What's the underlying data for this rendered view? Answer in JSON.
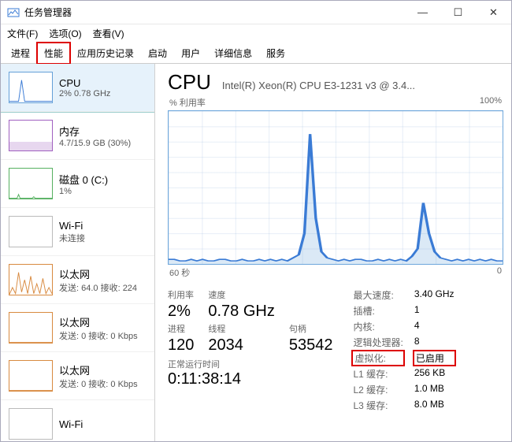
{
  "window": {
    "title": "任务管理器",
    "minimize": "—",
    "maximize": "☐",
    "close": "✕"
  },
  "menu": {
    "file": "文件(F)",
    "options": "选项(O)",
    "view": "查看(V)"
  },
  "tabs": {
    "processes": "进程",
    "performance": "性能",
    "app_history": "应用历史记录",
    "startup": "启动",
    "users": "用户",
    "details": "详细信息",
    "services": "服务"
  },
  "sidebar": [
    {
      "name": "cpu",
      "title": "CPU",
      "sub": "2% 0.78 GHz"
    },
    {
      "name": "memory",
      "title": "内存",
      "sub": "4.7/15.9 GB (30%)"
    },
    {
      "name": "disk",
      "title": "磁盘 0 (C:)",
      "sub": "1%"
    },
    {
      "name": "wifi",
      "title": "Wi-Fi",
      "sub": "未连接"
    },
    {
      "name": "eth0",
      "title": "以太网",
      "sub": "发送: 64.0 接收: 224"
    },
    {
      "name": "eth1",
      "title": "以太网",
      "sub": "发送: 0 接收: 0 Kbps"
    },
    {
      "name": "eth2",
      "title": "以太网",
      "sub": "发送: 0 接收: 0 Kbps"
    },
    {
      "name": "wifi2",
      "title": "Wi-Fi",
      "sub": ""
    }
  ],
  "cpu": {
    "heading": "CPU",
    "model": "Intel(R) Xeon(R) CPU E3-1231 v3 @ 3.4...",
    "chart_top_left": "% 利用率",
    "chart_top_right": "100%",
    "chart_bottom_left": "60 秒",
    "chart_bottom_right": "0",
    "labels": {
      "util": "利用率",
      "speed": "速度",
      "procs": "进程",
      "threads": "线程",
      "handles": "句柄",
      "uptime": "正常运行时间",
      "max_speed": "最大速度:",
      "sockets": "插槽:",
      "cores": "内核:",
      "lps": "逻辑处理器:",
      "virt": "虚拟化:",
      "l1": "L1 缓存:",
      "l2": "L2 缓存:",
      "l3": "L3 缓存:"
    },
    "values": {
      "util": "2%",
      "speed": "0.78 GHz",
      "procs": "120",
      "threads": "2034",
      "handles": "53542",
      "uptime": "0:11:38:14",
      "max_speed": "3.40 GHz",
      "sockets": "1",
      "cores": "4",
      "lps": "8",
      "virt": "已启用",
      "l1": "256 KB",
      "l2": "1.0 MB",
      "l3": "8.0 MB"
    }
  },
  "chart_data": {
    "type": "line",
    "title": "% 利用率",
    "xlabel": "60 秒",
    "ylabel": "",
    "ylim": [
      0,
      100
    ],
    "xlim_seconds": [
      60,
      0
    ],
    "series": [
      {
        "name": "CPU %",
        "values": [
          3,
          3,
          2,
          2,
          3,
          2,
          3,
          2,
          2,
          3,
          3,
          2,
          2,
          3,
          2,
          2,
          3,
          2,
          3,
          2,
          3,
          2,
          4,
          6,
          20,
          85,
          30,
          8,
          4,
          3,
          2,
          3,
          2,
          3,
          3,
          2,
          2,
          3,
          2,
          3,
          2,
          3,
          2,
          5,
          10,
          40,
          20,
          8,
          4,
          3,
          2,
          3,
          2,
          3,
          2,
          3,
          2,
          3,
          2,
          2
        ]
      }
    ]
  }
}
